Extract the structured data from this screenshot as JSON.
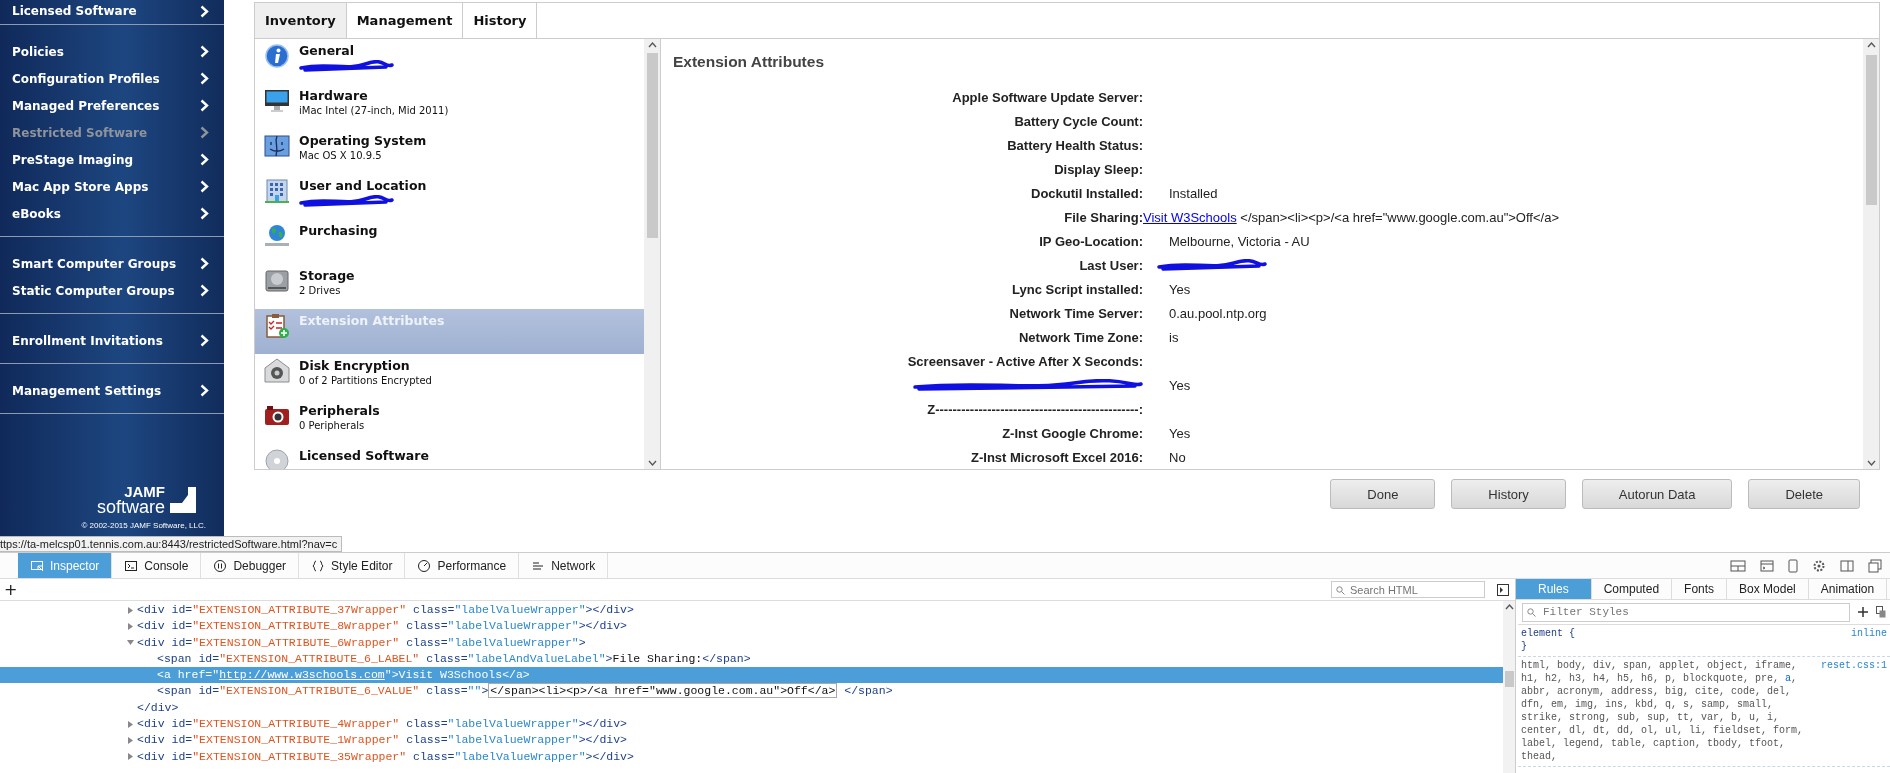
{
  "sidebar": {
    "groups": [
      {
        "items": [
          {
            "label": "Licensed Software",
            "disabled": false
          }
        ]
      },
      {
        "items": [
          {
            "label": "Policies",
            "disabled": false
          },
          {
            "label": "Configuration Profiles",
            "disabled": false
          },
          {
            "label": "Managed Preferences",
            "disabled": false
          },
          {
            "label": "Restricted Software",
            "disabled": true
          },
          {
            "label": "PreStage Imaging",
            "disabled": false
          },
          {
            "label": "Mac App Store Apps",
            "disabled": false
          },
          {
            "label": "eBooks",
            "disabled": false
          }
        ]
      },
      {
        "items": [
          {
            "label": "Smart Computer Groups",
            "disabled": false
          },
          {
            "label": "Static Computer Groups",
            "disabled": false
          }
        ]
      },
      {
        "items": [
          {
            "label": "Enrollment Invitations",
            "disabled": false
          }
        ]
      },
      {
        "items": [
          {
            "label": "Management Settings",
            "disabled": false
          }
        ]
      }
    ],
    "logo": {
      "brand": "JAMF",
      "product": "software",
      "copyright": "© 2002-2015 JAMF Software, LLC."
    }
  },
  "status_url": "ttps://ta-melcsp01.tennis.com.au:8443/restrictedSoftware.html?nav=c",
  "tabs": [
    {
      "label": "Inventory",
      "selected": true
    },
    {
      "label": "Management",
      "selected": false
    },
    {
      "label": "History",
      "selected": false
    }
  ],
  "inventory": [
    {
      "kind": "info",
      "title": "General",
      "redacted": true,
      "selected": false
    },
    {
      "kind": "monitor",
      "title": "Hardware",
      "subtitle": "iMac Intel (27-inch, Mid 2011)",
      "redacted": false,
      "selected": false
    },
    {
      "kind": "finder",
      "title": "Operating System",
      "subtitle": "Mac OS X 10.9.5",
      "redacted": false,
      "selected": false
    },
    {
      "kind": "building",
      "title": "User and Location",
      "redacted": true,
      "selected": false
    },
    {
      "kind": "globe",
      "title": "Purchasing",
      "redacted": false,
      "selected": false
    },
    {
      "kind": "disk",
      "title": "Storage",
      "subtitle": "2 Drives",
      "redacted": false,
      "selected": false
    },
    {
      "kind": "clipboard",
      "title": "Extension Attributes",
      "redacted": false,
      "selected": true
    },
    {
      "kind": "lock",
      "title": "Disk Encryption",
      "subtitle": "0 of 2 Partitions Encrypted",
      "redacted": false,
      "selected": false
    },
    {
      "kind": "camera",
      "title": "Peripherals",
      "subtitle": "0 Peripherals",
      "redacted": false,
      "selected": false
    },
    {
      "kind": "cd",
      "title": "Licensed Software",
      "redacted": false,
      "selected": false
    }
  ],
  "attributes": {
    "title": "Extension Attributes",
    "rows": [
      {
        "label": "Apple Software Update Server:"
      },
      {
        "label": "Battery Cycle Count:"
      },
      {
        "label": "Battery Health Status:"
      },
      {
        "label": "Display Sleep:"
      },
      {
        "label": "Dockutil Installed:",
        "value": "Installed"
      },
      {
        "label": "File Sharing:",
        "link": "Visit W3Schools",
        "value": "</span><li><p>/<a href=\"www.google.com.au\">Off</a>"
      },
      {
        "label": "IP Geo-Location:",
        "value": "Melbourne, Victoria - AU"
      },
      {
        "label": "Last User:",
        "redacted_value": true
      },
      {
        "label": "Lync Script installed:",
        "value": "Yes"
      },
      {
        "label": "Network Time Server:",
        "value": "0.au.pool.ntp.org"
      },
      {
        "label": "Network Time Zone:",
        "value": "is"
      },
      {
        "label": "Screensaver - Active After X Seconds:"
      },
      {
        "redacted_label": true,
        "value": "Yes"
      },
      {
        "label": "Z-----------------------------------------------:"
      },
      {
        "label": "Z-Inst Google Chrome:",
        "value": "Yes"
      },
      {
        "label": "Z-Inst Microsoft Excel 2016:",
        "value": "No"
      }
    ]
  },
  "buttons": [
    "Done",
    "History",
    "Autorun Data",
    "Delete"
  ],
  "devtools": {
    "tools": [
      {
        "kind": "inspector",
        "label": "Inspector",
        "selected": true
      },
      {
        "kind": "console",
        "label": "Console",
        "selected": false
      },
      {
        "kind": "debugger",
        "label": "Debugger",
        "selected": false
      },
      {
        "kind": "braces",
        "label": "Style Editor",
        "selected": false
      },
      {
        "kind": "gauge",
        "label": "Performance",
        "selected": false
      },
      {
        "kind": "network",
        "label": "Network",
        "selected": false
      }
    ],
    "add_label": "+",
    "search": {
      "placeholder": "Search HTML"
    },
    "side_tabs": [
      {
        "label": "Rules",
        "selected": true
      },
      {
        "label": "Computed",
        "selected": false
      },
      {
        "label": "Fonts",
        "selected": false
      },
      {
        "label": "Box Model",
        "selected": false
      },
      {
        "label": "Animation",
        "selected": false
      }
    ],
    "nodes": [
      {
        "expanded": false,
        "selected": false,
        "segments": [
          {
            "kind": "tag",
            "t": "<div"
          },
          {
            "kind": "attr",
            "t": " id="
          },
          {
            "kind": "idval",
            "t": "\"EXTENSION_ATTRIBUTE_37Wrapper\""
          },
          {
            "kind": "attr",
            "t": " class="
          },
          {
            "kind": "val",
            "t": "\"labelValueWrapper\""
          },
          {
            "kind": "tag",
            "t": "></div>"
          }
        ]
      },
      {
        "expanded": false,
        "selected": false,
        "segments": [
          {
            "kind": "tag",
            "t": "<div"
          },
          {
            "kind": "attr",
            "t": " id="
          },
          {
            "kind": "idval",
            "t": "\"EXTENSION_ATTRIBUTE_8Wrapper\""
          },
          {
            "kind": "attr",
            "t": " class="
          },
          {
            "kind": "val",
            "t": "\"labelValueWrapper\""
          },
          {
            "kind": "tag",
            "t": "></div>"
          }
        ]
      },
      {
        "expanded": true,
        "selected": false,
        "segments": [
          {
            "kind": "tag",
            "t": "<div"
          },
          {
            "kind": "attr",
            "t": " id="
          },
          {
            "kind": "idval",
            "t": "\"EXTENSION_ATTRIBUTE_6Wrapper\""
          },
          {
            "kind": "attr",
            "t": " class="
          },
          {
            "kind": "val",
            "t": "\"labelValueWrapper\""
          },
          {
            "kind": "tag",
            "t": ">"
          }
        ],
        "children": [
          {
            "selected": false,
            "segments": [
              {
                "kind": "tag",
                "t": "<span"
              },
              {
                "kind": "attr",
                "t": " id="
              },
              {
                "kind": "idval",
                "t": "\"EXTENSION_ATTRIBUTE_6_LABEL\""
              },
              {
                "kind": "attr",
                "t": " class="
              },
              {
                "kind": "val",
                "t": "\"labelAndValueLabel\""
              },
              {
                "kind": "tag",
                "t": ">"
              },
              {
                "kind": "text",
                "t": "File Sharing:"
              },
              {
                "kind": "tag",
                "t": "</span>"
              }
            ]
          },
          {
            "selected": true,
            "segments": [
              {
                "kind": "tag",
                "t": "<a"
              },
              {
                "kind": "attr",
                "t": " href="
              },
              {
                "kind": "val",
                "t": "\""
              },
              {
                "kind": "link",
                "t": "http://www.w3schools.com"
              },
              {
                "kind": "val",
                "t": "\""
              },
              {
                "kind": "tag",
                "t": ">"
              },
              {
                "kind": "text",
                "t": "Visit W3Schools"
              },
              {
                "kind": "tag",
                "t": "</a>"
              }
            ]
          },
          {
            "selected": false,
            "segments": [
              {
                "kind": "tag",
                "t": "<span"
              },
              {
                "kind": "attr",
                "t": " id="
              },
              {
                "kind": "idval",
                "t": "\"EXTENSION_ATTRIBUTE_6_VALUE\""
              },
              {
                "kind": "attr",
                "t": " class="
              },
              {
                "kind": "val",
                "t": "\"\""
              },
              {
                "kind": "tag",
                "t": ">"
              },
              {
                "kind": "boxed",
                "t": "</span><li><p>/<a href=\"www.google.com.au\">Off</a>"
              },
              {
                "kind": "tag",
                "t": " </span>"
              }
            ]
          }
        ],
        "closing": "</div>"
      },
      {
        "expanded": false,
        "selected": false,
        "segments": [
          {
            "kind": "tag",
            "t": "<div"
          },
          {
            "kind": "attr",
            "t": " id="
          },
          {
            "kind": "idval",
            "t": "\"EXTENSION_ATTRIBUTE_4Wrapper\""
          },
          {
            "kind": "attr",
            "t": " class="
          },
          {
            "kind": "val",
            "t": "\"labelValueWrapper\""
          },
          {
            "kind": "tag",
            "t": "></div>"
          }
        ]
      },
      {
        "expanded": false,
        "selected": false,
        "segments": [
          {
            "kind": "tag",
            "t": "<div"
          },
          {
            "kind": "attr",
            "t": " id="
          },
          {
            "kind": "idval",
            "t": "\"EXTENSION_ATTRIBUTE_1Wrapper\""
          },
          {
            "kind": "attr",
            "t": " class="
          },
          {
            "kind": "val",
            "t": "\"labelValueWrapper\""
          },
          {
            "kind": "tag",
            "t": "></div>"
          }
        ]
      },
      {
        "expanded": false,
        "selected": false,
        "segments": [
          {
            "kind": "tag",
            "t": "<div"
          },
          {
            "kind": "attr",
            "t": " id="
          },
          {
            "kind": "idval",
            "t": "\"EXTENSION_ATTRIBUTE_35Wrapper\""
          },
          {
            "kind": "attr",
            "t": " class="
          },
          {
            "kind": "val",
            "t": "\"labelValueWrapper\""
          },
          {
            "kind": "tag",
            "t": "></div>"
          }
        ]
      }
    ],
    "filter": {
      "placeholder": "Filter Styles"
    },
    "rules": [
      {
        "selector": [
          {
            "t": "element {"
          }
        ],
        "source": "inline",
        "close": "}"
      },
      {
        "selector": [
          {
            "t": "html, body, div, span, applet, object, iframe, h1, h2, h3, h4, h5, h6, p, blockquote, pre, ",
            "matched": false
          },
          {
            "t": "a",
            "matched": true
          },
          {
            "t": ", abbr, acronym, address, big, cite, code, del, dfn, em, img, ins, kbd, q, s, samp, small, strike, strong, sub, sup, tt, var, b, u, i, center, dl, dt, dd, ol, ul, li, fieldset, form, label, legend, table, caption, tbody, tfoot, thead,",
            "matched": false
          }
        ],
        "source": "reset.css:1"
      }
    ]
  }
}
